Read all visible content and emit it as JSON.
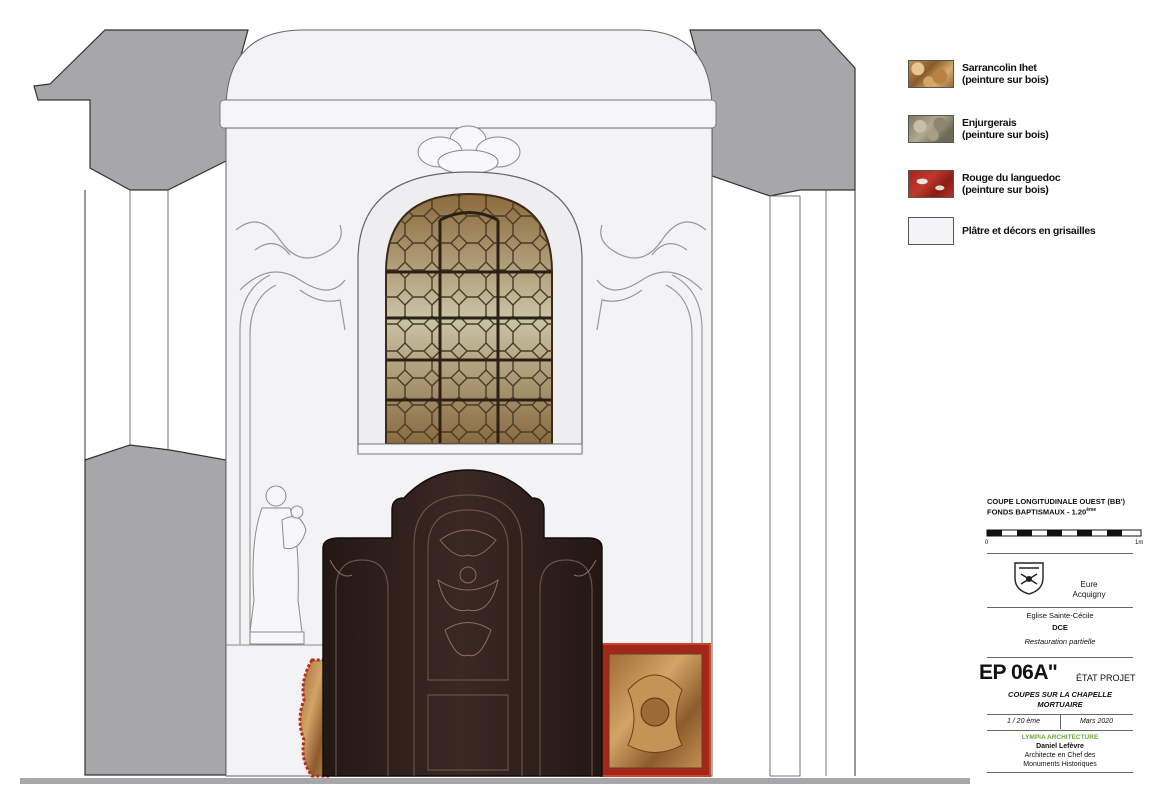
{
  "legend": {
    "items": [
      {
        "line1": "Sarrancolin Ihet",
        "line2": "(peinture sur bois)"
      },
      {
        "line1": "Enjurgerais",
        "line2": "(peinture sur bois)"
      },
      {
        "line1": "Rouge du languedoc",
        "line2": "(peinture sur bois)"
      },
      {
        "line1": "Plâtre et décors en grisailles",
        "line2": ""
      }
    ]
  },
  "titleblock": {
    "section_title": "COUPE LONGITUDINALE OUEST (BB')",
    "section_sub": "FONDS BAPTISMAUX - 1.20",
    "section_sup": "ème",
    "scale_start": "0",
    "scale_end": "1m",
    "department": "Eure",
    "commune": "Acquigny",
    "church": "Eglise Sainte-Cécile",
    "phase": "DCE",
    "works": "Restauration partielle",
    "sheet_number": "EP 06A''",
    "sheet_status": "ÉTAT PROJET",
    "sheet_title_1": "COUPES SUR LA CHAPELLE",
    "sheet_title_2": "MORTUAIRE",
    "scale": "1 / 20 ème",
    "date": "Mars 2020",
    "firm": "LYMPIA ARCHITECTURE",
    "architect": "Daniel Lefèvre",
    "role_1": "Architecte en Chef des",
    "role_2": "Monuments Historiques"
  },
  "colors": {
    "section_grey": "#a7a7a9",
    "wall": "#f3f3f5",
    "door_wood": "#2e1f1b",
    "firm_green": "#6aa83a",
    "marble_red": "#b23124"
  }
}
